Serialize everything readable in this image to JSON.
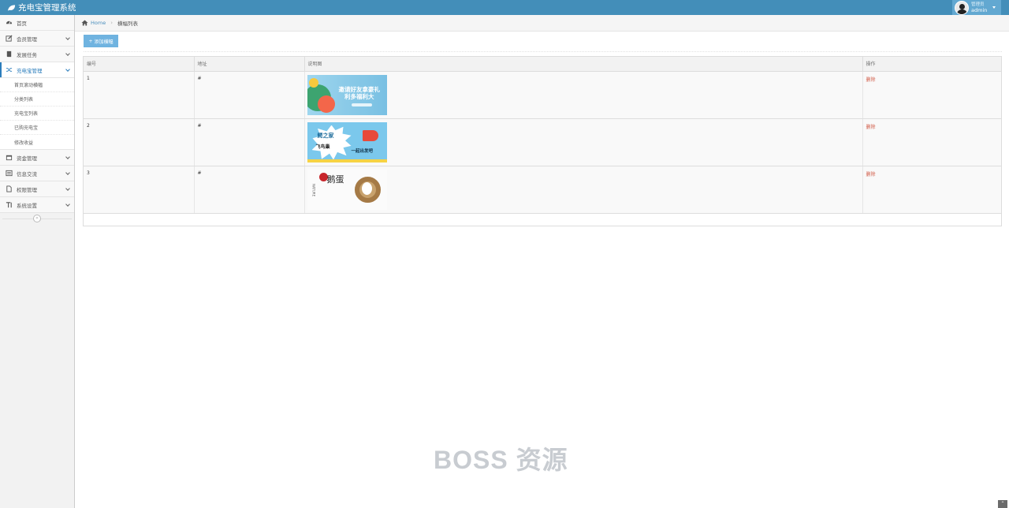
{
  "navbar": {
    "brand": "充电宝管理系统",
    "user_role": "管理员",
    "user_name": "admin"
  },
  "sidebar": {
    "items": [
      {
        "label": "首页",
        "icon": "tachometer-icon"
      },
      {
        "label": "会员管理",
        "icon": "edit-icon"
      },
      {
        "label": "发展任务",
        "icon": "book-icon"
      },
      {
        "label": "充电宝管理",
        "icon": "random-icon"
      },
      {
        "label": "资金管理",
        "icon": "calendar-icon"
      },
      {
        "label": "信息交流",
        "icon": "list-alt-icon"
      },
      {
        "label": "权限管理",
        "icon": "file-icon"
      },
      {
        "label": "系统设置",
        "icon": "text-height-icon"
      }
    ],
    "submenu": [
      {
        "label": "首页滚动横幅"
      },
      {
        "label": "分类列表"
      },
      {
        "label": "充电宝列表"
      },
      {
        "label": "已购充电宝"
      },
      {
        "label": "修改收益"
      }
    ]
  },
  "breadcrumb": {
    "home": "Home",
    "current": "横幅列表"
  },
  "toolbar": {
    "add_label": "添加横幅"
  },
  "table": {
    "headers": [
      "编号",
      "地址",
      "说明图",
      "操作"
    ],
    "rows": [
      {
        "id": "1",
        "address": "#",
        "action": "删除",
        "image_text": "邀请好友拿豪礼\n利多福利大"
      },
      {
        "id": "2",
        "address": "#",
        "action": "删除",
        "image_text": "鳄之家"
      },
      {
        "id": "3",
        "address": "#",
        "action": "删除",
        "image_text": "鹅蛋"
      }
    ]
  },
  "watermark": "BOSS 资源",
  "colors": {
    "navbar": "#438eb9",
    "user_box": "#62a8d1",
    "accent": "#2b7dbc",
    "button": "#6fb3e0",
    "delete": "#d15b47"
  }
}
